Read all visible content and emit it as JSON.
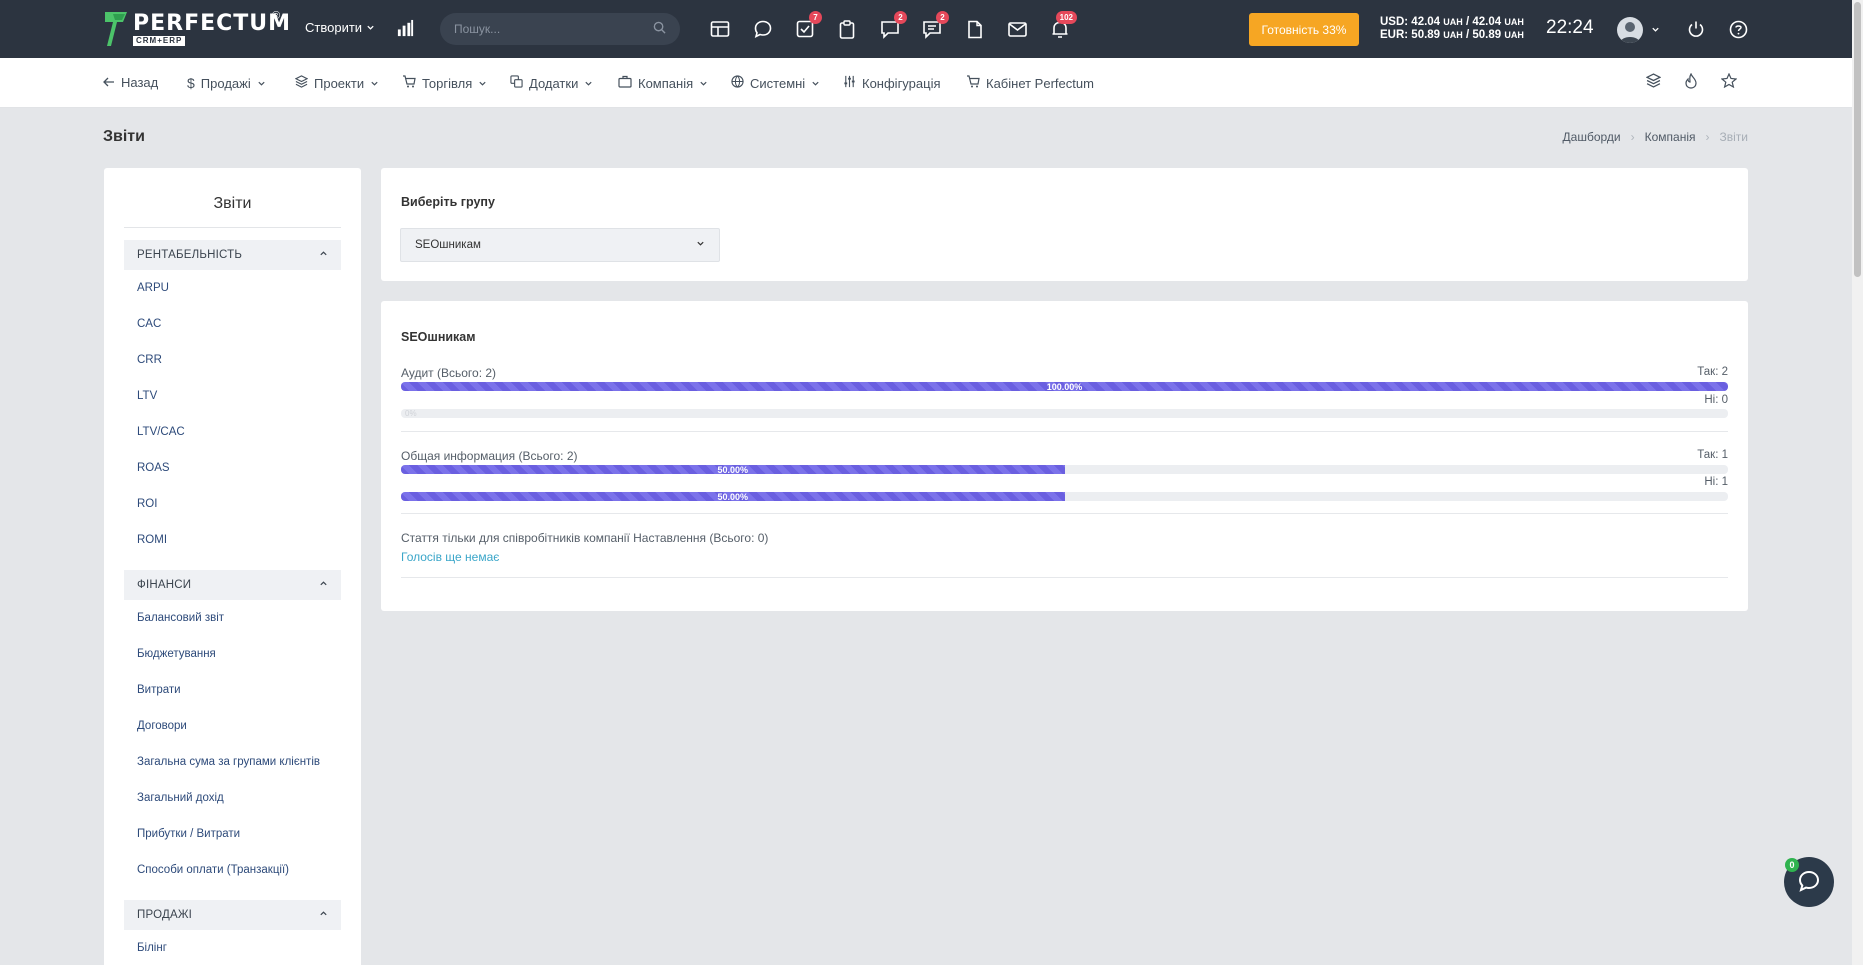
{
  "topbar": {
    "logo_name": "PERFECTUM",
    "logo_sub": "CRM+ERP",
    "logo_reg": "®",
    "create_label": "Створити",
    "search_placeholder": "Пошук...",
    "badges": {
      "tasks": "7",
      "chat": "2",
      "comments": "2",
      "notifications": "102"
    },
    "ready_label": "Готовність 33%",
    "usd_rate": "USD: 42.04",
    "usd_rate2": "/ 42.04",
    "eur_rate": "EUR: 50.89",
    "eur_rate2": "/ 50.89",
    "currency_unit": "UAH",
    "time": "22:24"
  },
  "nav": {
    "back": "Назад",
    "sales": "Продажі",
    "projects": "Проекти",
    "trade": "Торгівля",
    "addons": "Додатки",
    "company": "Компанія",
    "system": "Системні",
    "config": "Конфігурація",
    "cabinet": "Кабінет Perfectum"
  },
  "page": {
    "title": "Звіти",
    "breadcrumb": [
      "Дашборди",
      "Компанія",
      "Звіти"
    ]
  },
  "sidebar": {
    "title": "Звіти",
    "groups": [
      {
        "label": "РЕНТАБЕЛЬНІСТЬ",
        "items": [
          "ARPU",
          "CAC",
          "CRR",
          "LTV",
          "LTV/CAC",
          "ROAS",
          "ROI",
          "ROMI"
        ]
      },
      {
        "label": "ФІНАНСИ",
        "items": [
          "Балансовий звіт",
          "Бюджетування",
          "Витрати",
          "Договори",
          "Загальна сума за групами клієнтів",
          "Загальний дохід",
          "Прибутки / Витрати",
          "Способи оплати (Транзакції)"
        ]
      },
      {
        "label": "ПРОДАЖІ",
        "items": [
          "Білінг"
        ]
      }
    ]
  },
  "select_panel": {
    "label": "Виберіть групу",
    "selected": "SEOшникам"
  },
  "results": {
    "title": "SEOшникам",
    "questions": [
      {
        "title": "Аудит (Всього: 2)",
        "yes_label": "Так: 2",
        "no_label": "Ні: 0",
        "yes_pct": 100,
        "yes_text": "100.00%",
        "no_pct": 0,
        "no_text": "0%"
      },
      {
        "title": "Общая информация (Всього: 2)",
        "yes_label": "Так: 1",
        "no_label": "Ні: 1",
        "yes_pct": 50,
        "yes_text": "50.00%",
        "no_pct": 50,
        "no_text": "50.00%"
      }
    ],
    "empty_question": {
      "title": "Стаття тільки для співробітників компанії Наставлення (Всього: 0)",
      "note": "Голосів ще немає"
    }
  },
  "chat": {
    "badge": "0"
  },
  "colors": {
    "accent": "#6a5fe0",
    "topbar": "#2c3440",
    "ready": "#f6a623",
    "badge": "#e5485a",
    "link": "#3aa6c9"
  }
}
